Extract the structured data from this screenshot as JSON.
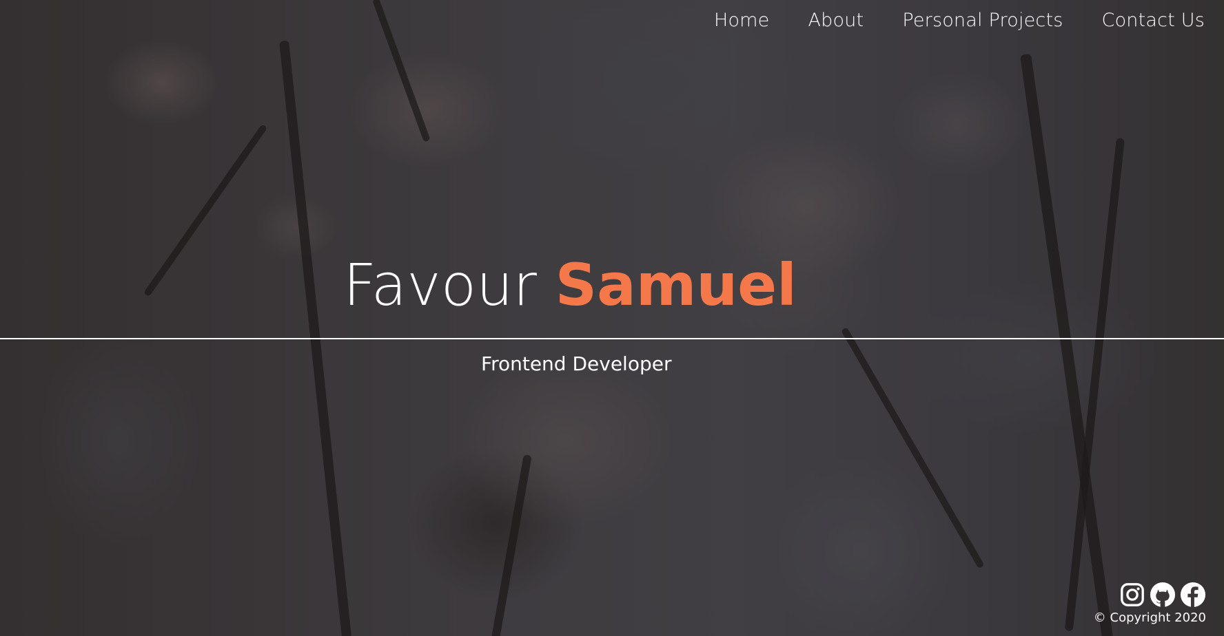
{
  "nav": {
    "items": [
      {
        "label": "Home"
      },
      {
        "label": "About"
      },
      {
        "label": "Personal Projects"
      },
      {
        "label": "Contact Us"
      }
    ]
  },
  "hero": {
    "first_name": "Favour",
    "last_name": "Samuel",
    "role": "Frontend Developer"
  },
  "footer": {
    "social": [
      {
        "icon": "instagram-icon"
      },
      {
        "icon": "github-icon"
      },
      {
        "icon": "facebook-icon"
      }
    ],
    "copyright": "© Copyright 2020"
  },
  "colors": {
    "accent": "#f5784a",
    "text": "#ffffff"
  }
}
